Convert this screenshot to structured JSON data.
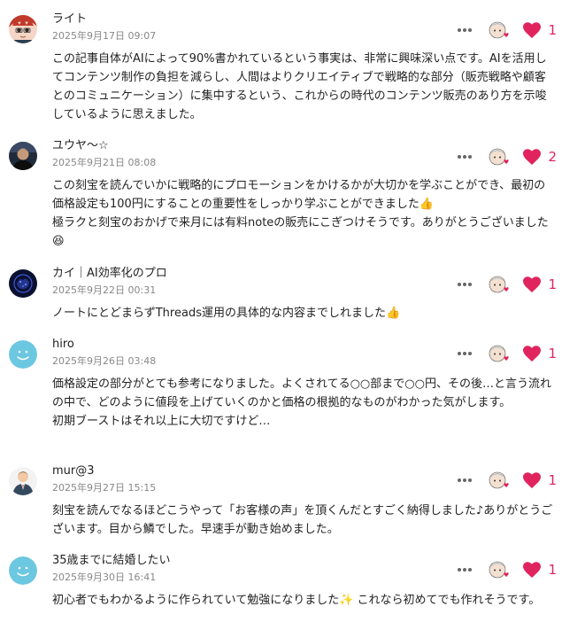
{
  "colors": {
    "heart": "#e0245e",
    "meta": "#888888",
    "text": "#222222"
  },
  "comments": [
    {
      "name": "ライト",
      "date": "2025年9月17日 09:07",
      "likes": "1",
      "avatar_icon": "anime-boy-red-avatar",
      "body": [
        "この記事自体がAIによって90%書かれているという事実は、非常に興味深い点です。AIを活用してコンテンツ制作の負担を減らし、人間はよりクリエイティブで戦略的な部分（販売戦略や顧客とのコミュニケーション）に集中するという、これからの時代のコンテンツ販売のあり方を示唆しているように思えました。"
      ]
    },
    {
      "name": "ユウヤ〜☆",
      "date": "2025年9月21日 08:08",
      "likes": "2",
      "avatar_icon": "photo-man-avatar",
      "body": [
        "この刻宝を読んでいかに戦略的にプロモーションをかけるかが大切かを学ぶことができ、最初の価格設定も100円にすることの重要性をしっかり学ぶことができました👍",
        "極ラクと刻宝のおかげで来月には有料noteの販売にこぎつけそうです。ありがとうございました😆"
      ]
    },
    {
      "name": "カイ｜AI効率化のプロ",
      "date": "2025年9月22日 00:31",
      "likes": "1",
      "avatar_icon": "dark-brain-avatar",
      "body": [
        "ノートにとどまらずThreads運用の具体的な内容までしれました👍"
      ]
    },
    {
      "name": "hiro",
      "date": "2025年9月26日 03:48",
      "likes": "1",
      "avatar_icon": "default-smile-avatar",
      "body": [
        "価格設定の部分がとても参考になりました。よくされてる○○部まで○○円、その後…と言う流れの中で、どのように値段を上げていくのかと価格の根拠的なものがわかった気がします。",
        "初期ブーストはそれ以上に大切ですけど…"
      ]
    },
    {
      "name": "mur@3",
      "date": "2025年9月27日 15:15",
      "likes": "1",
      "avatar_icon": "businessman-avatar",
      "body": [
        "刻宝を読んでなるほどこうやって「お客様の声」を頂くんだとすごく納得しました♪ありがとうございます。目から鱗でした。早速手が動き始めました。"
      ]
    },
    {
      "name": "35歳までに結婚したい",
      "date": "2025年9月30日 16:41",
      "likes": "1",
      "avatar_icon": "default-smile-avatar",
      "body": [
        "初心者でもわかるように作られていて勉強になりました✨ これなら初めてでも作れそうです。"
      ]
    }
  ]
}
